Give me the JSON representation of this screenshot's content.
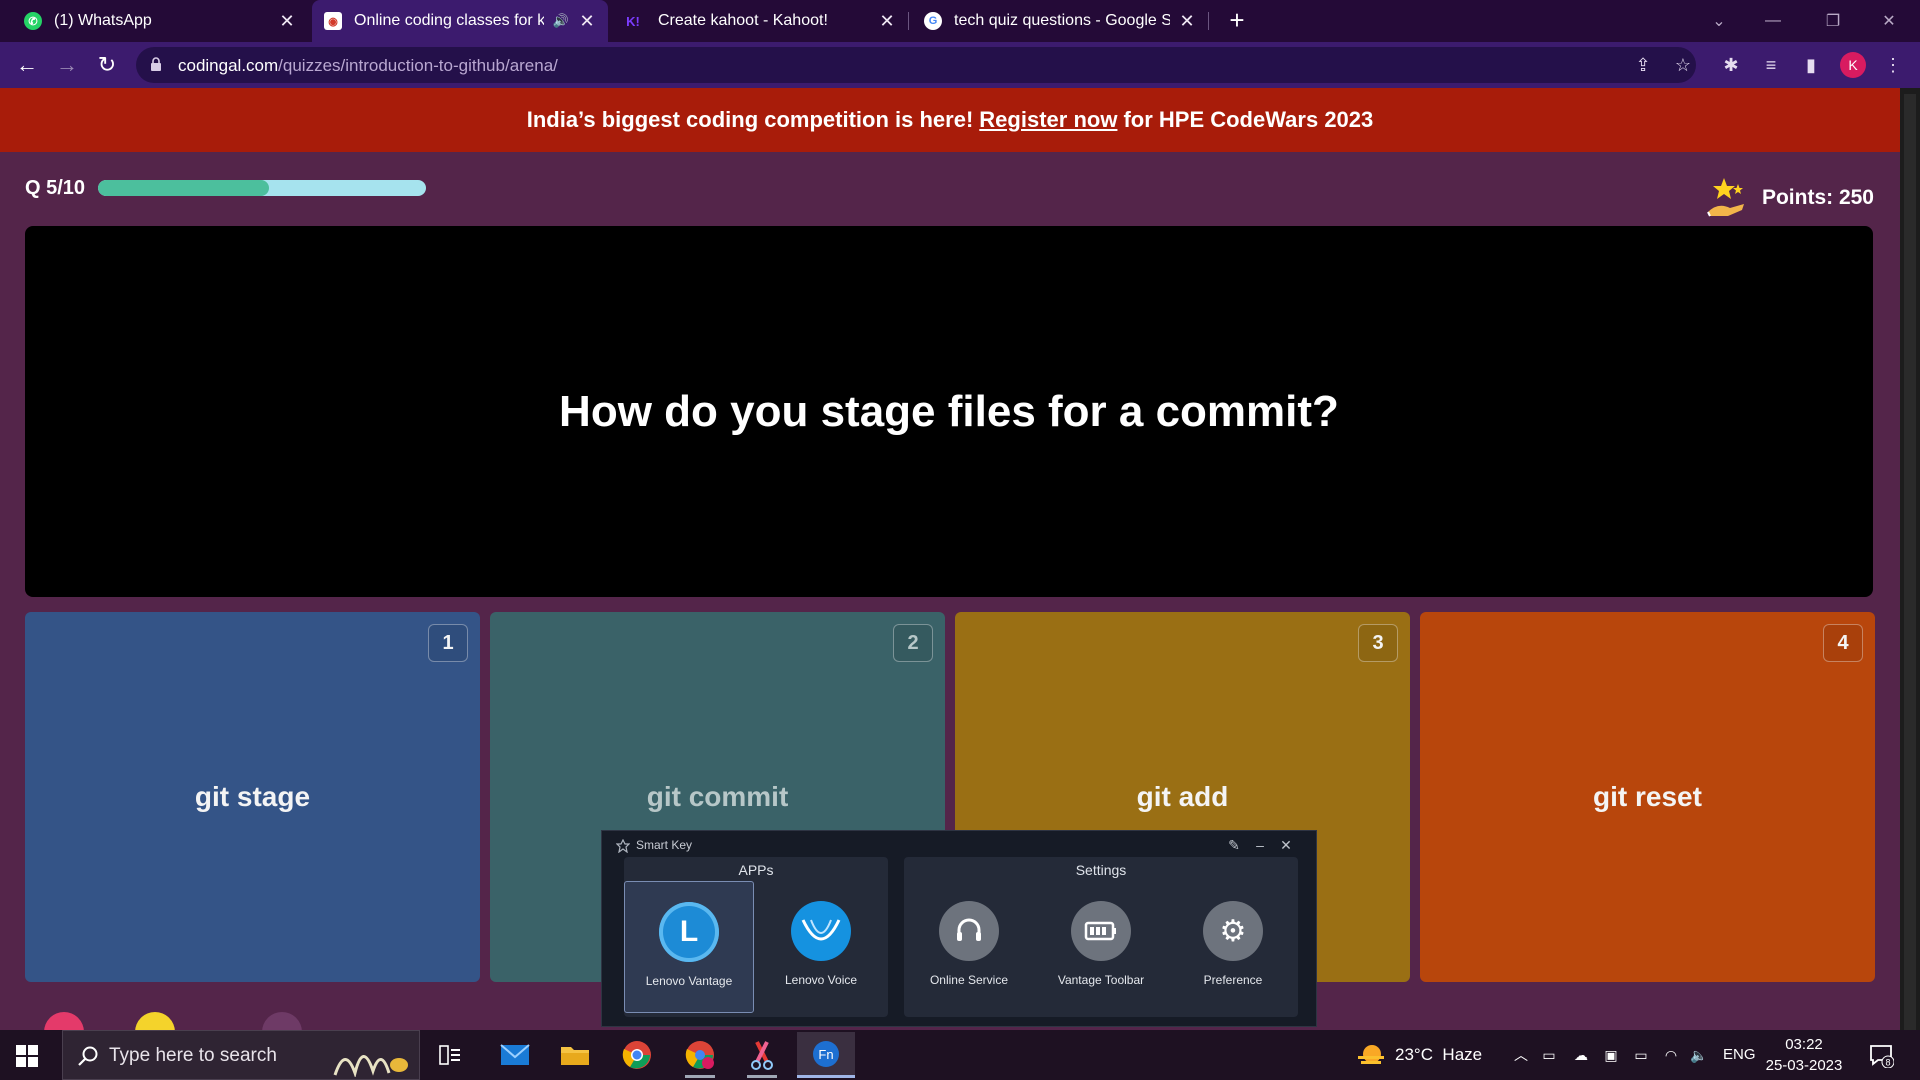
{
  "browser": {
    "tabs": [
      {
        "title": "(1) WhatsApp",
        "icon": "whatsapp-icon",
        "active": false
      },
      {
        "title": "Online coding classes for kid",
        "icon": "codingal-icon",
        "active": true
      },
      {
        "title": "Create kahoot - Kahoot!",
        "icon": "kahoot-icon",
        "active": false
      },
      {
        "title": "tech quiz questions - Google Sea",
        "icon": "google-icon",
        "active": false
      }
    ],
    "new_tab": "+",
    "url_host": "codingal.com",
    "url_path": "/quizzes/introduction-to-github/arena/",
    "profile_initial": "K"
  },
  "banner": {
    "before": "India’s biggest coding competition is here!",
    "link": "Register now",
    "after": "for HPE CodeWars 2023"
  },
  "quiz": {
    "question_counter": "Q 5/10",
    "progress": 0.52,
    "points_label": "Points: 250",
    "question": "How do you stage files for a commit?",
    "options": [
      {
        "number": "1",
        "text": "git stage",
        "color": "#345487"
      },
      {
        "number": "2",
        "text": "git commit",
        "color": "#3a6268"
      },
      {
        "number": "3",
        "text": "git add",
        "color": "#9a6f14"
      },
      {
        "number": "4",
        "text": "git reset",
        "color": "#b8460c"
      }
    ]
  },
  "smart_key": {
    "title": "Smart Key",
    "apps_heading": "APPs",
    "settings_heading": "Settings",
    "apps": [
      {
        "label": "Lenovo Vantage",
        "icon": "lenovo-vantage-icon"
      },
      {
        "label": "Lenovo Voice",
        "icon": "lenovo-voice-icon"
      }
    ],
    "settings": [
      {
        "label": "Online Service",
        "icon": "headset-icon"
      },
      {
        "label": "Vantage Toolbar",
        "icon": "battery-icon"
      },
      {
        "label": "Preference",
        "icon": "gear-icon"
      }
    ]
  },
  "taskbar": {
    "search_placeholder": "Type here to search",
    "weather": "23°C  Haze",
    "language": "ENG",
    "time": "03:22",
    "date": "25-03-2023",
    "notification_count": "8"
  }
}
